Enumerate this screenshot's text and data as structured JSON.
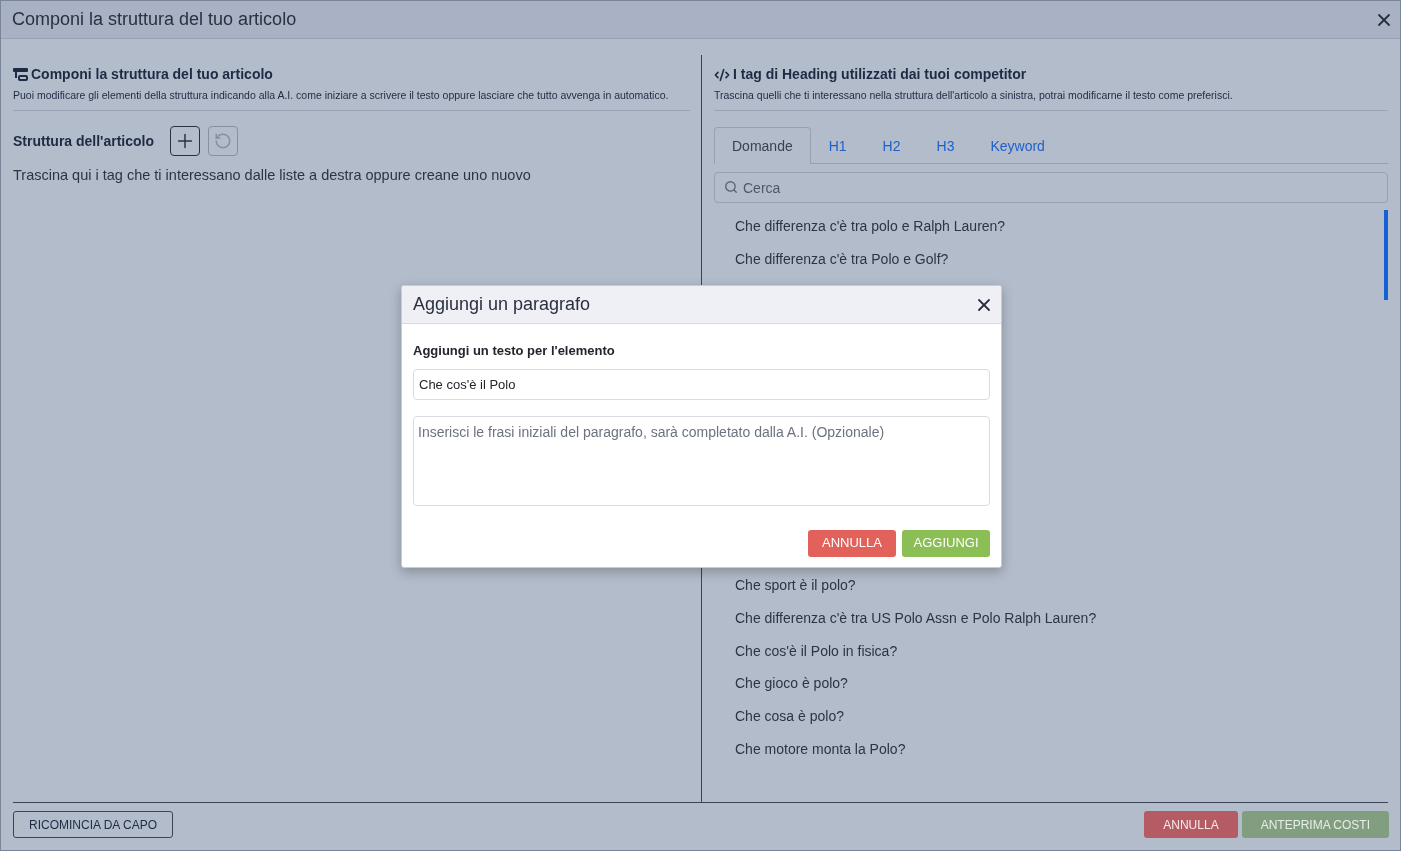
{
  "dialog": {
    "title": "Componi la struttura del tuo articolo"
  },
  "left_panel": {
    "heading": "Componi la struttura del tuo articolo",
    "description": "Puoi modificare gli elementi della struttura indicando alla A.I. come iniziare a scrivere il testo oppure lasciare che tutto avvenga in automatico.",
    "structure_label": "Struttura dell'articolo",
    "structure_actions": [
      {
        "kind": "add",
        "disabled": false
      },
      {
        "kind": "undo",
        "disabled": true
      }
    ],
    "hint": "Trascina qui i tag che ti interessano dalle liste a destra oppure creane uno nuovo"
  },
  "right_panel": {
    "heading": "I tag di Heading utilizzati dai tuoi competitor",
    "description": "Trascina quelli che ti interessano nella struttura dell'articolo a sinistra, potrai modificarne il testo come preferisci.",
    "tabs": [
      {
        "label": "Domande",
        "selected": true
      },
      {
        "label": "H1",
        "selected": false
      },
      {
        "label": "H2",
        "selected": false
      },
      {
        "label": "H3",
        "selected": false
      },
      {
        "label": "Keyword",
        "selected": false
      }
    ],
    "search": {
      "placeholder": "Cerca"
    },
    "questions_upper": [
      "Che differenza c'è tra polo e Ralph Lauren?",
      "Che differenza c'è tra Polo e Golf?"
    ],
    "questions_lower": [
      "Che sport è il polo?",
      "Che differenza c'è tra US Polo Assn e Polo Ralph Lauren?",
      "Che cos'è il Polo in fisica?",
      "Che gioco è polo?",
      "Che cosa è polo?",
      "Che motore monta la Polo?"
    ]
  },
  "footer": {
    "buttons": [
      {
        "label": "RICOMINCIA DA CAPO",
        "kind": "outline",
        "disabled": false
      },
      {
        "label": "ANNULLA",
        "kind": "danger",
        "disabled": false
      },
      {
        "label": "ANTEPRIMA COSTI",
        "kind": "success",
        "disabled": true
      }
    ]
  },
  "modal": {
    "title": "Aggiungi un paragrafo",
    "field_label": "Aggiungi un testo per l'elemento",
    "text_value": "Che cos'è il Polo",
    "paragraph_placeholder": "Inserisci le frasi iniziali del paragrafo, sarà completato dalla A.I. (Opzionale)",
    "buttons": [
      {
        "label": "ANNULLA",
        "kind": "danger"
      },
      {
        "label": "AGGIUNGI",
        "kind": "success"
      }
    ]
  }
}
